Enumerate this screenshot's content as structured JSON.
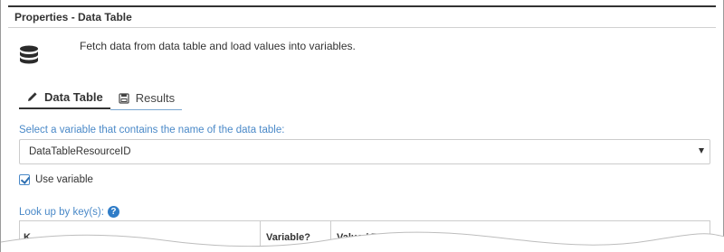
{
  "panel": {
    "title": "Properties - Data Table",
    "description": "Fetch data from data table and load values into variables."
  },
  "icons": {
    "panel_icon": "database-icon",
    "data_table_tab_icon": "pencil-icon",
    "results_tab_icon": "floppy-disk-icon",
    "help_icon": "question-circle-icon"
  },
  "tabs": [
    {
      "label": "Data Table",
      "active": true
    },
    {
      "label": "Results",
      "active": false
    }
  ],
  "table_select": {
    "label": "Select a variable that contains the name of the data table:",
    "value": "DataTableResourceID"
  },
  "use_variable": {
    "label": "Use variable",
    "checked": true
  },
  "lookup": {
    "label": "Look up by key(s):",
    "help_glyph": "?",
    "columns": [
      "K",
      "Variable?",
      "Value / Expre"
    ]
  },
  "colors": {
    "accent": "#4a89c8",
    "help": "#2f7cc7",
    "border": "#cccccc"
  }
}
